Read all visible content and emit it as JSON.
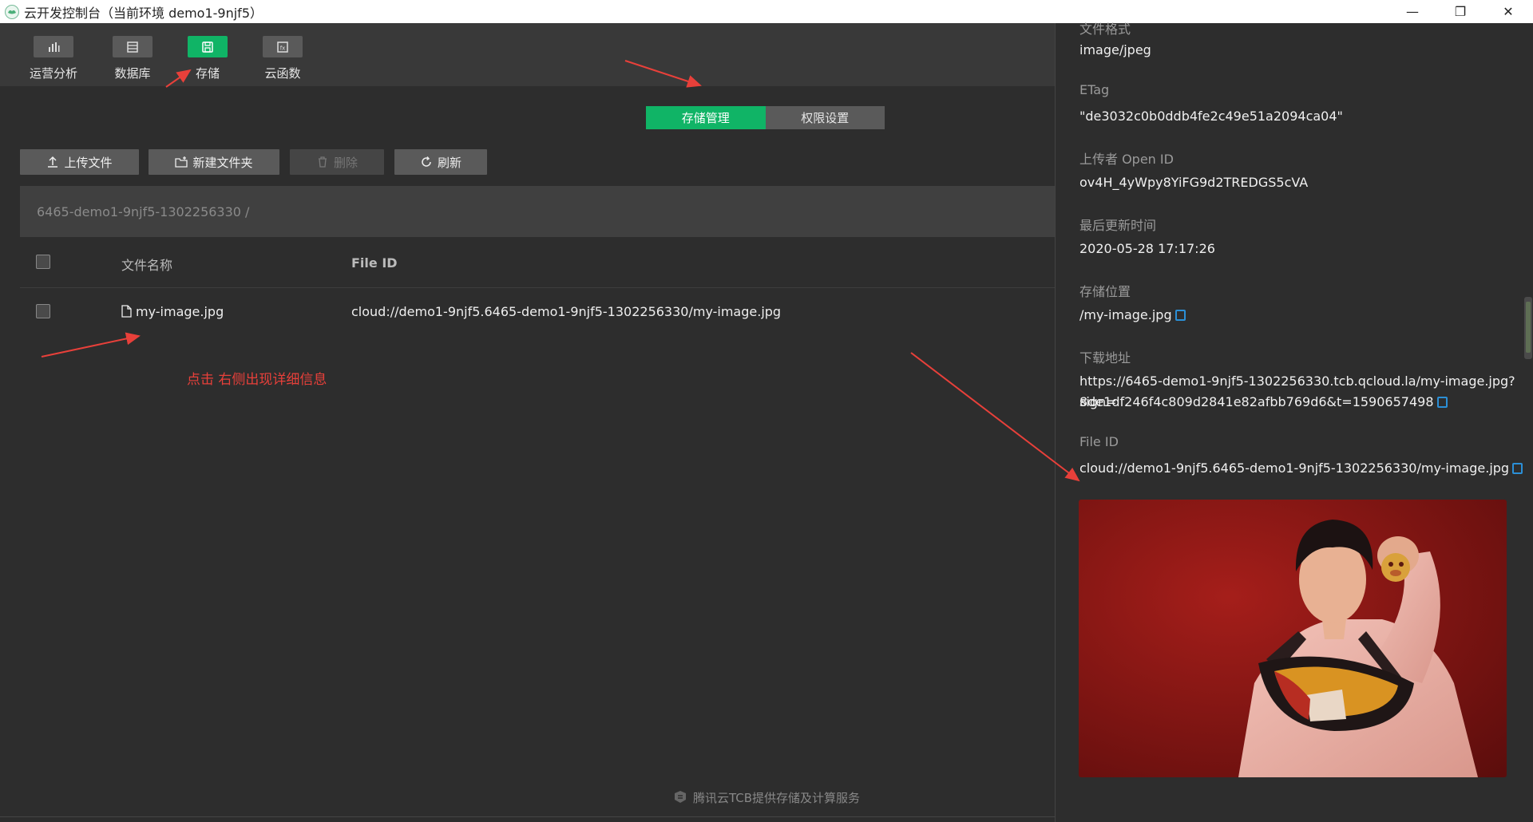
{
  "window": {
    "title": "云开发控制台（当前环境 demo1-9njf5）",
    "controls": {
      "minimize": "—",
      "restore": "❐",
      "close": "✕"
    }
  },
  "nav": {
    "items": [
      {
        "label": "运营分析",
        "icon": "bar-chart-icon"
      },
      {
        "label": "数据库",
        "icon": "database-icon"
      },
      {
        "label": "存储",
        "icon": "save-icon",
        "active": true
      },
      {
        "label": "云函数",
        "icon": "function-icon"
      }
    ]
  },
  "tabs": {
    "storage_manage": "存储管理",
    "permission": "权限设置"
  },
  "toolbar": {
    "upload": "上传文件",
    "new_folder": "新建文件夹",
    "delete": "删除",
    "refresh": "刷新"
  },
  "path": "6465-demo1-9njf5-1302256330 /",
  "table": {
    "headers": {
      "name": "文件名称",
      "file_id": "File ID"
    },
    "rows": [
      {
        "name": "my-image.jpg",
        "file_id": "cloud://demo1-9njf5.6465-demo1-9njf5-1302256330/my-image.jpg"
      }
    ]
  },
  "annotation": "点击  右侧出现详细信息",
  "footer": "腾讯云TCB提供存储及计算服务",
  "detail": {
    "format_label": "文件格式",
    "format_value": "image/jpeg",
    "etag_label": "ETag",
    "etag_value": "\"de3032c0b0ddb4fe2c49e51a2094ca04\"",
    "uploader_label": "上传者 Open ID",
    "uploader_value": "ov4H_4yWpy8YiFG9d2TREDGS5cVA",
    "updated_label": "最后更新时间",
    "updated_value": "2020-05-28 17:17:26",
    "location_label": "存储位置",
    "location_value": "/my-image.jpg",
    "download_label": "下载地址",
    "download_line1": "https://6465-demo1-9njf5-1302256330.tcb.qcloud.la/my-image.jpg?sign=",
    "download_line2": "8de1df246f4c809d2841e82afbb769d6&t=1590657498",
    "fileid_label": "File ID",
    "fileid_value": "cloud://demo1-9njf5.6465-demo1-9njf5-1302256330/my-image.jpg"
  },
  "colors": {
    "accent": "#10b466",
    "annotation": "#e8403a",
    "copy_icon": "#2b8fd6"
  }
}
